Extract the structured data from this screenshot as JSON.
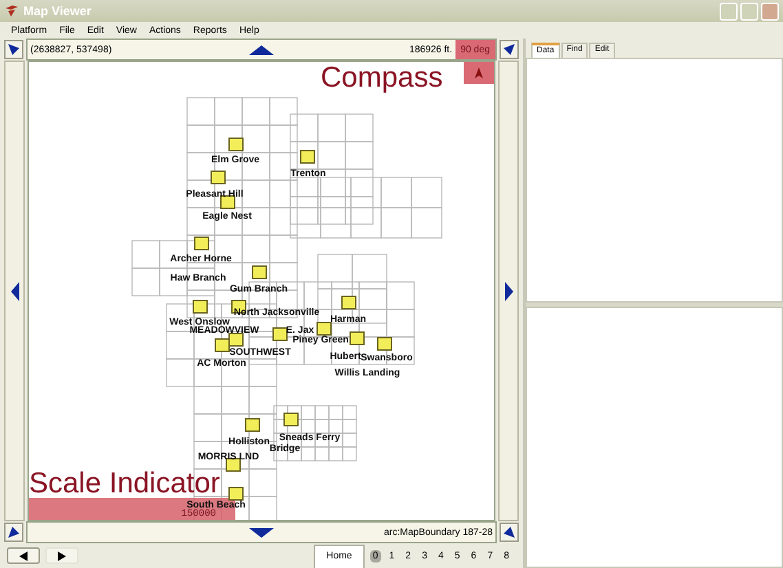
{
  "window": {
    "title": "Map Viewer"
  },
  "menu": [
    "Platform",
    "File",
    "Edit",
    "View",
    "Actions",
    "Reports",
    "Help"
  ],
  "nav": {
    "coordinates": "(2638827, 537498)",
    "distance": "186926 ft.",
    "heading": "90 deg"
  },
  "map": {
    "places": [
      {
        "name": "Elm Grove",
        "marker": true
      },
      {
        "name": "Trenton",
        "marker": true
      },
      {
        "name": "Pleasant Hill",
        "marker": true
      },
      {
        "name": "Eagle Nest",
        "marker": true
      },
      {
        "name": "Archer Horne",
        "marker": true
      },
      {
        "name": "Haw Branch",
        "marker": false
      },
      {
        "name": "Gum Branch",
        "marker": true
      },
      {
        "name": "North Jacksonville",
        "marker": true
      },
      {
        "name": "West Onslow",
        "marker": true
      },
      {
        "name": "Harman",
        "marker": true
      },
      {
        "name": "MEADOWVIEW",
        "marker": true
      },
      {
        "name": "E. Jax",
        "marker": true
      },
      {
        "name": "Piney Green",
        "marker": true
      },
      {
        "name": "SOUTHWEST",
        "marker": true
      },
      {
        "name": "AC Morton",
        "marker": false
      },
      {
        "name": "Hubert",
        "marker": true
      },
      {
        "name": "Swansboro",
        "marker": true
      },
      {
        "name": "Willis Landing",
        "marker": false
      },
      {
        "name": "Holliston",
        "marker": true
      },
      {
        "name": "Sneads Ferry",
        "marker": true
      },
      {
        "name": "Bridge",
        "marker": false
      },
      {
        "name": "MORRIS LND",
        "marker": true
      },
      {
        "name": "South Beach",
        "marker": true
      }
    ]
  },
  "scale_bar": {
    "value": "150000"
  },
  "annotations": {
    "compass": "Compass",
    "scale": "Scale Indicator"
  },
  "status": {
    "layer": "arc:MapBoundary 187-28"
  },
  "footer": {
    "home": "Home",
    "pages": [
      {
        "label": "0",
        "selected": true
      },
      {
        "label": "1",
        "selected": false
      },
      {
        "label": "2",
        "selected": false
      },
      {
        "label": "3",
        "selected": false
      },
      {
        "label": "4",
        "selected": false
      },
      {
        "label": "5",
        "selected": false
      },
      {
        "label": "6",
        "selected": false
      },
      {
        "label": "7",
        "selected": false
      },
      {
        "label": "8",
        "selected": false
      }
    ]
  },
  "side_tabs": [
    {
      "label": "Data",
      "selected": true
    },
    {
      "label": "Find",
      "selected": false
    },
    {
      "label": "Edit",
      "selected": false
    }
  ]
}
